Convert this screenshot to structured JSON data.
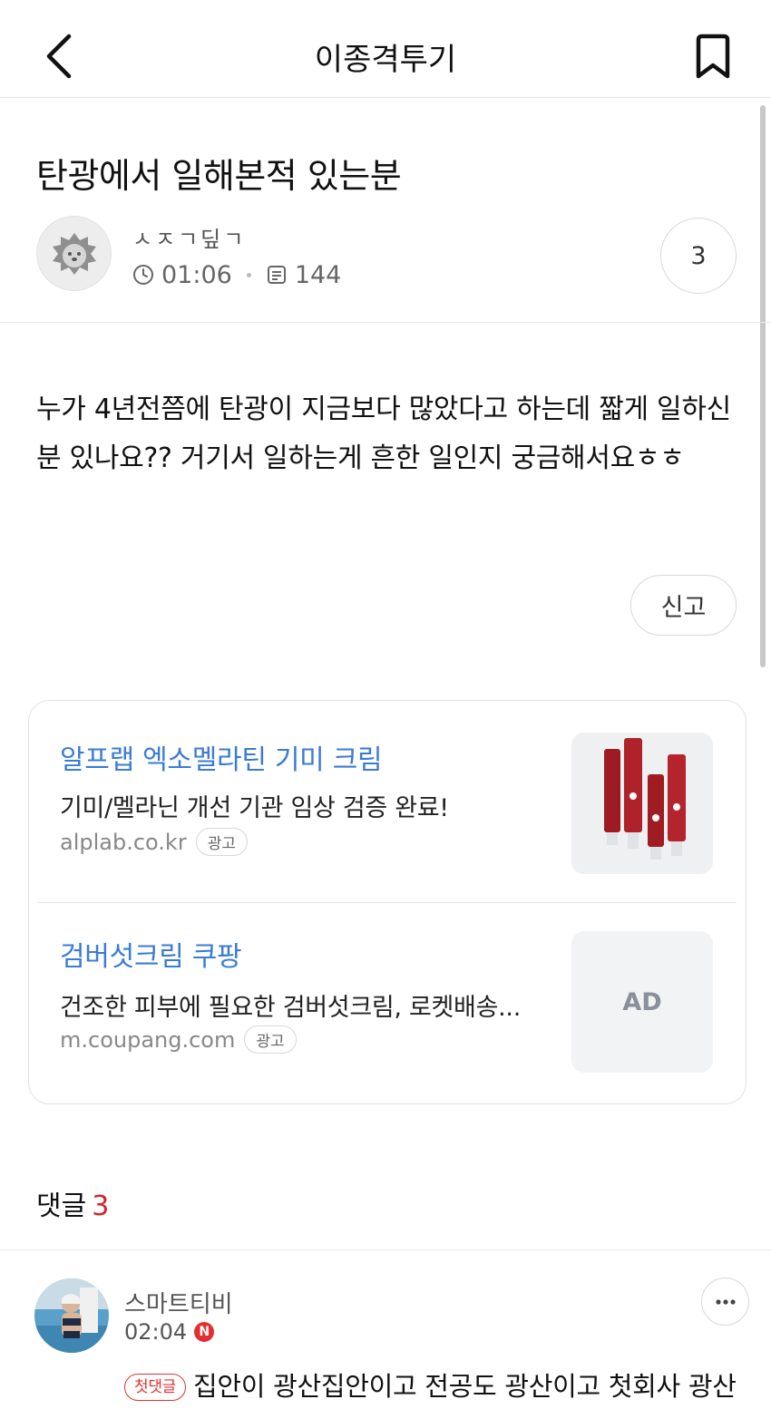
{
  "header": {
    "title": "이종격투기"
  },
  "post": {
    "title": "탄광에서 일해본적 있는분",
    "author": "ㅅㅈㄱ딮ㄱ",
    "time": "01:06",
    "views": "144",
    "comment_count": "3",
    "body": "누가 4년전쯤에 탄광이 지금보다 많았다고 하는데 짧게 일하신분 있나요?? 거기서 일하는게 흔한 일인지 궁금해서요ㅎㅎ",
    "report_label": "신고"
  },
  "ads": [
    {
      "title": "알프랩 엑소멜라틴 기미 크림",
      "desc": "기미/멜라닌 개선 기관 임상 검증 완료!",
      "url": "alplab.co.kr",
      "label": "광고"
    },
    {
      "title": "검버섯크림 쿠팡",
      "desc": "건조한 피부에 필요한 검버섯크림, 로켓배송...",
      "url": "m.coupang.com",
      "label": "광고",
      "thumb_text": "AD"
    }
  ],
  "comments": {
    "label": "댓글",
    "count": "3",
    "items": [
      {
        "author": "스마트티비",
        "time": "02:04",
        "new_badge": "N",
        "first_badge": "첫댓글",
        "text": "집안이 광산집안이고 전공도 광산이고 첫회사 광산관련 회사였어서..."
      }
    ]
  },
  "colors": {
    "accent_red": "#d2222d",
    "ad_link_blue": "#3a7bd5"
  },
  "icons": [
    "back-icon",
    "bookmark-icon",
    "clock-icon",
    "views-icon",
    "more-icon"
  ]
}
